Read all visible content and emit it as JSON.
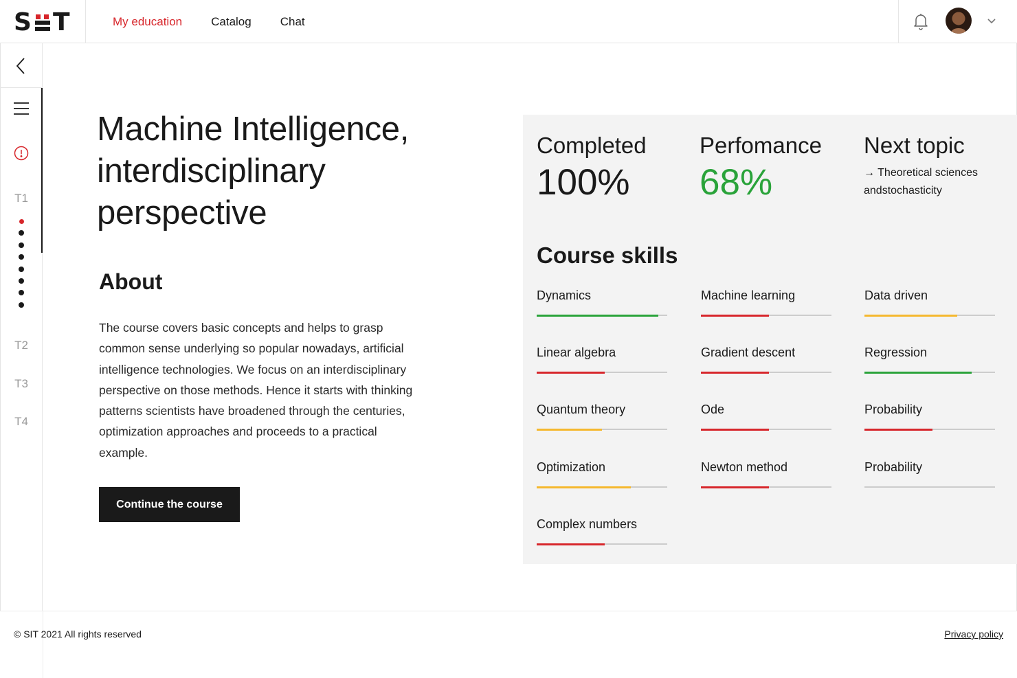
{
  "brand": {
    "logo_left": "S",
    "logo_right": "T"
  },
  "nav": {
    "items": [
      {
        "label": "My education",
        "active": true
      },
      {
        "label": "Catalog",
        "active": false
      },
      {
        "label": "Chat",
        "active": false
      }
    ]
  },
  "sidebar": {
    "topics": [
      "T1",
      "T2",
      "T3",
      "T4"
    ],
    "t1_lessons": 8,
    "t1_current_lesson": 1
  },
  "course": {
    "title": "Machine Intelligence, interdisciplinary perspective",
    "about_heading": "About",
    "about_text": "The course covers basic concepts and helps to grasp common sense underlying so popular nowadays, artificial intelligence technologies. We focus on an interdisciplinary perspective on those methods. Hence it starts with thinking patterns scientists have broadened through the centuries, optimization approaches and proceeds to a practical example.",
    "continue_label": "Continue the course"
  },
  "stats": {
    "completed_label": "Completed",
    "completed_value": "100%",
    "performance_label": "Perfomance",
    "performance_value": "68%",
    "next_topic_label": "Next topic",
    "next_topic_value": "→ Theoretical sciences andstochasticity"
  },
  "skills_heading": "Course skills",
  "skills": [
    {
      "name": "Dynamics",
      "level": 0.93,
      "color": "#2aa33a"
    },
    {
      "name": "Machine learning",
      "level": 0.52,
      "color": "#d7262b"
    },
    {
      "name": "Data driven",
      "level": 0.71,
      "color": "#f5b82e"
    },
    {
      "name": "Linear algebra",
      "level": 0.52,
      "color": "#d7262b"
    },
    {
      "name": "Gradient descent",
      "level": 0.52,
      "color": "#d7262b"
    },
    {
      "name": "Regression",
      "level": 0.82,
      "color": "#2aa33a"
    },
    {
      "name": "Quantum theory",
      "level": 0.5,
      "color": "#f5b82e"
    },
    {
      "name": "Ode",
      "level": 0.52,
      "color": "#d7262b"
    },
    {
      "name": "Probability",
      "level": 0.52,
      "color": "#d7262b"
    },
    {
      "name": "Optimization",
      "level": 0.72,
      "color": "#f5b82e"
    },
    {
      "name": "Newton method",
      "level": 0.52,
      "color": "#d7262b"
    },
    {
      "name": "Probability",
      "level": 0,
      "color": "#d7262b"
    },
    {
      "name": "Complex numbers",
      "level": 0.52,
      "color": "#d7262b"
    }
  ],
  "footer": {
    "copyright": "© SIT 2021 All rights reserved",
    "privacy": "Privacy policy"
  },
  "colors": {
    "accent": "#d7262b",
    "success": "#2aa33a",
    "warning": "#f5b82e",
    "panel": "#f3f3f3"
  }
}
